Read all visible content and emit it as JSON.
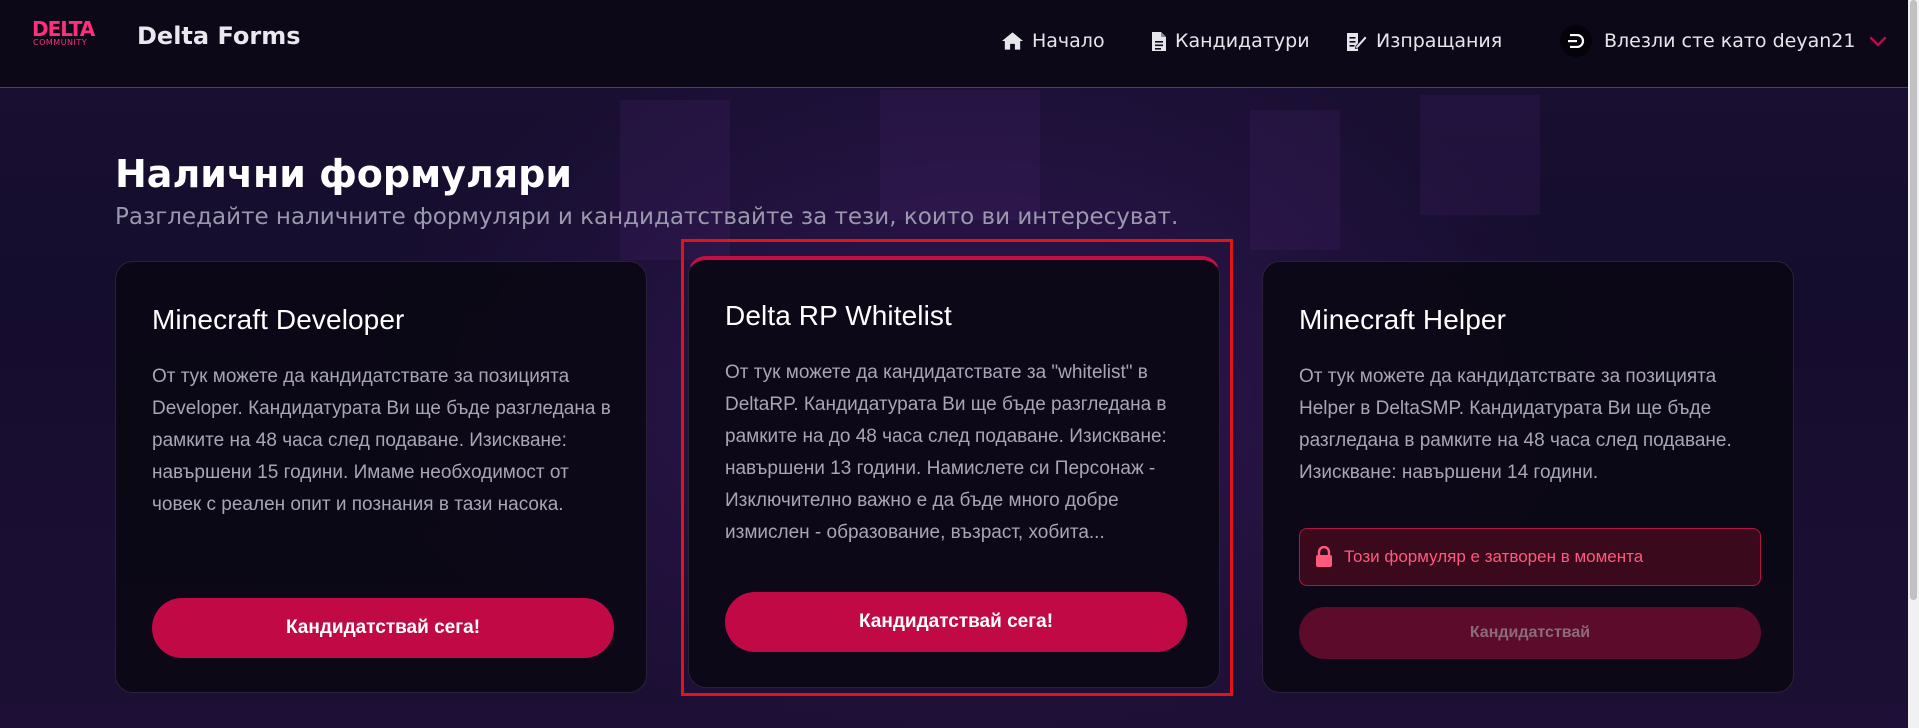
{
  "header": {
    "logo_top": "DELTA",
    "logo_bottom": "COMMUNITY",
    "brand": "Delta Forms",
    "nav": [
      {
        "label": "Начало",
        "icon": "home-icon"
      },
      {
        "label": "Кандидатури",
        "icon": "document-icon"
      },
      {
        "label": "Изпращания",
        "icon": "edit-document-icon"
      }
    ],
    "user_label": "Влезли сте като deyan21"
  },
  "main": {
    "title": "Налични формуляри",
    "subtitle": "Разгледайте наличните формуляри и кандидатствайте за тези, които ви интересуват."
  },
  "cards": [
    {
      "title": "Minecraft Developer",
      "description": "От тук можете да кандидатствате за позицията Developer. Кандидатурата Ви ще бъде разгледана в рамките на 48 часа след подаване. Изискване: навършени 15 години. Имаме необходимост от човек с реален опит и познания в тази насока.",
      "button": "Кандидатствай сега!"
    },
    {
      "title": "Delta RP Whitelist",
      "description": "От тук можете да кандидатствате за \"whitelist\" в DeltaRP. Кандидатурата Ви ще бъде разгледана в рамките на до 48 часа след подаване. Изискване: навършени 13 години. Намислете си Персонаж - Изключително важно е да бъде много добре измислен - образование, възраст, хобита...",
      "button": "Кандидатствай сега!"
    },
    {
      "title": "Minecraft Helper",
      "description": "От тук можете да кандидатствате за позицията Helper в DeltaSMP. Кандидатурата Ви ще бъде разгледана в рамките на 48 часа след подаване. Изискване: навършени 14 години.",
      "closed_notice": "Този формуляр е затворен в момента",
      "button": "Кандидатствай"
    }
  ],
  "colors": {
    "accent": "#c10a45",
    "header_bg": "#0d0818",
    "alert_text": "#ff5a7d",
    "highlight": "#e01419"
  }
}
